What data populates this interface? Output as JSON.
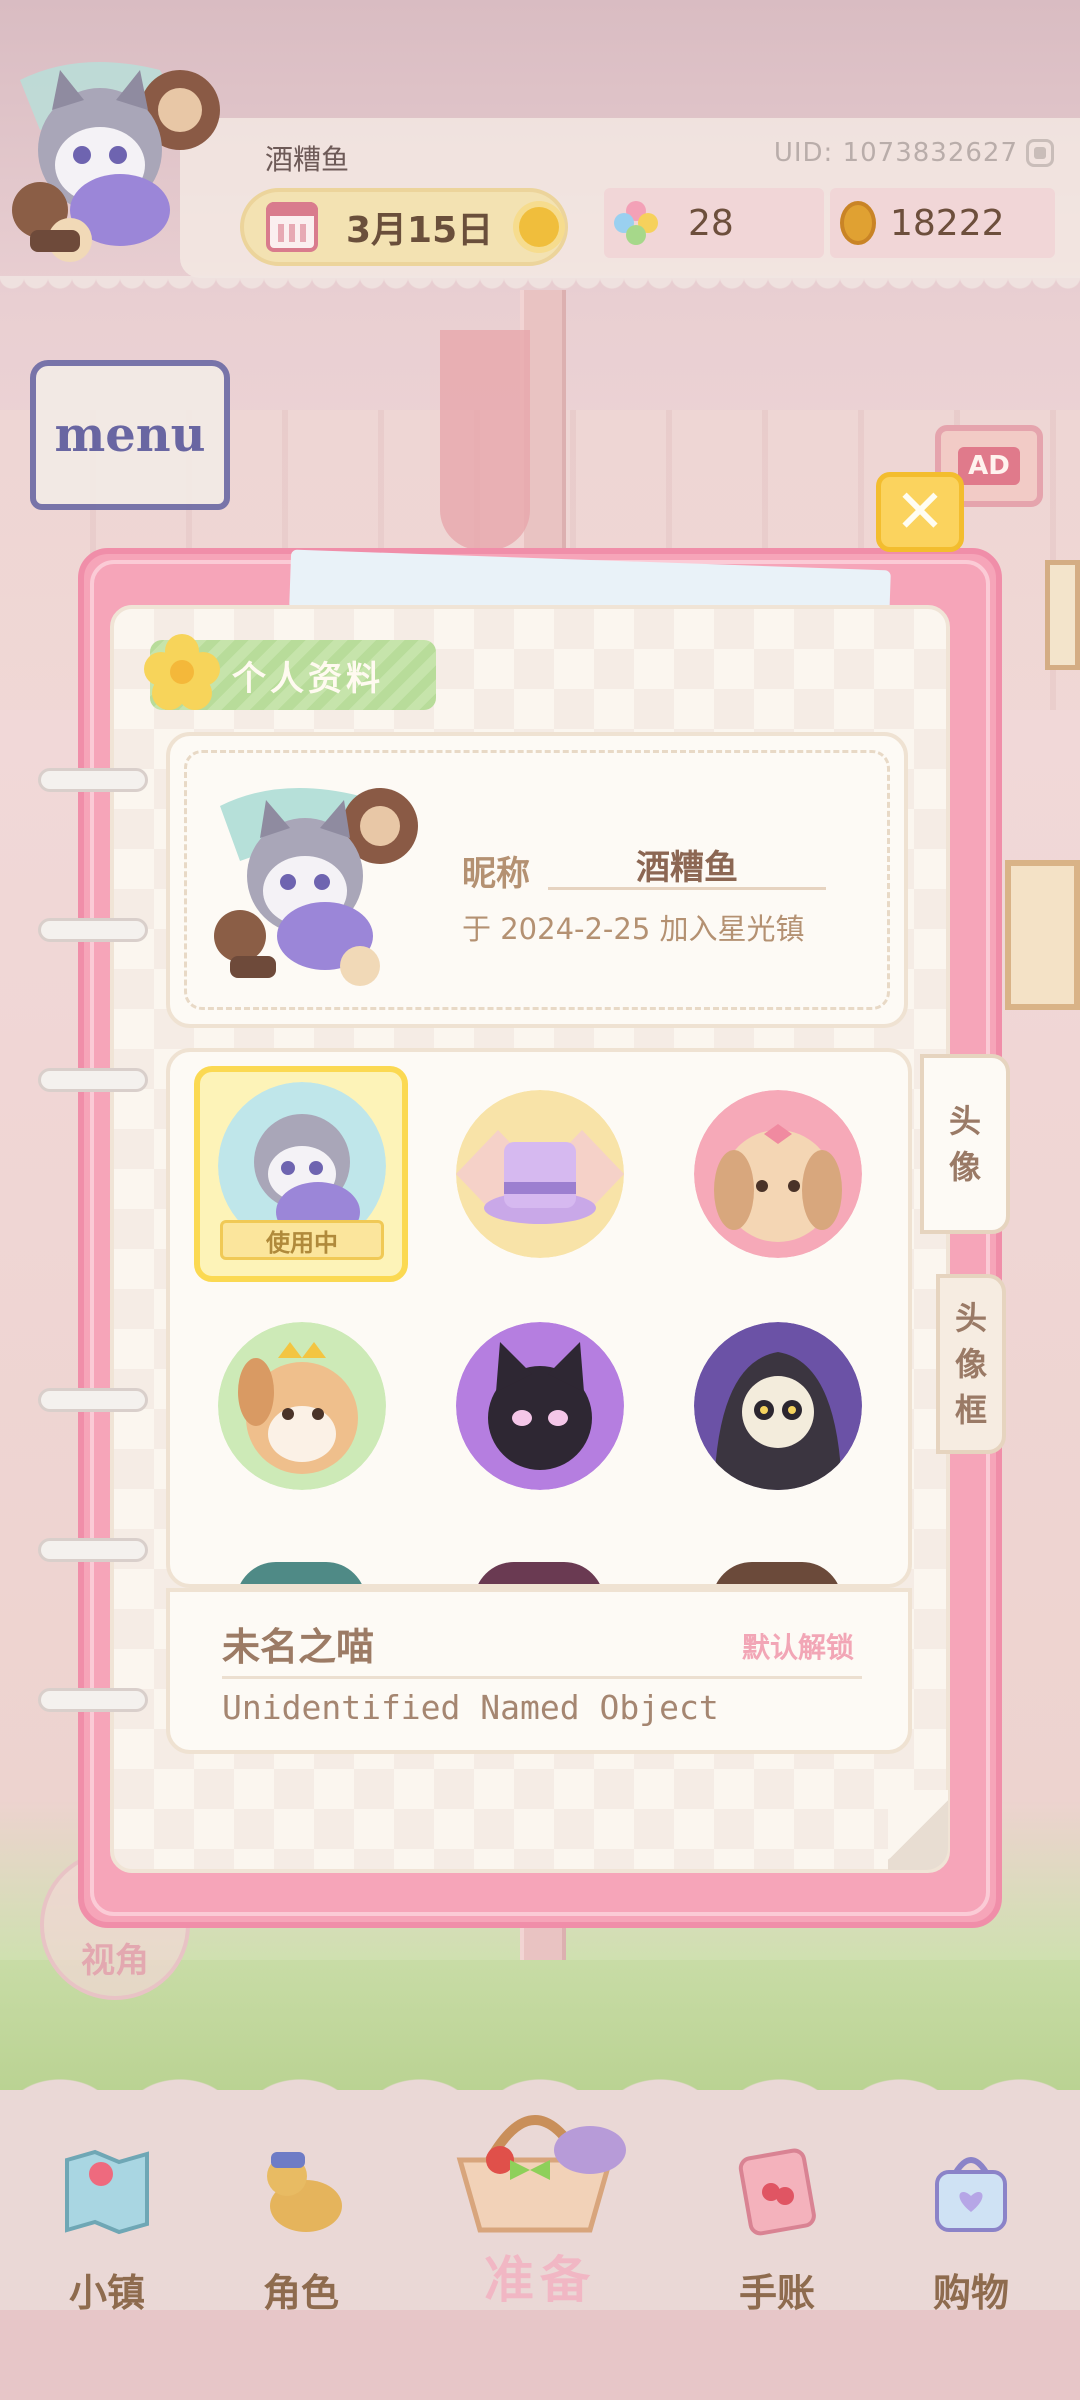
{
  "hud": {
    "player_name": "酒糟鱼",
    "uid": "UID: 1073832627",
    "date": "3月15日",
    "gems": "28",
    "coins": "18222"
  },
  "menu_label": "menu",
  "ad_label": "AD",
  "close_label": "✕",
  "view_label": "视角",
  "profile": {
    "section_title": "个人资料",
    "nickname_label": "昵称",
    "nickname_value": "酒糟鱼",
    "join_text": "于 2024-2-25 加入星光镇"
  },
  "avatar_grid": {
    "in_use_label": "使用中"
  },
  "side_tabs": [
    "头像",
    "头像框"
  ],
  "selected_info": {
    "title": "未名之喵",
    "unlock": "默认解锁",
    "description": "Unidentified Named Object"
  },
  "nav": {
    "items": [
      "小镇",
      "角色",
      "准备",
      "手账",
      "购物"
    ]
  },
  "colors": {
    "dialog_pink": "#f6a5b9",
    "paper": "#fbf6ef",
    "accent_yellow": "#fbd35e",
    "label_brown": "#b49172"
  }
}
